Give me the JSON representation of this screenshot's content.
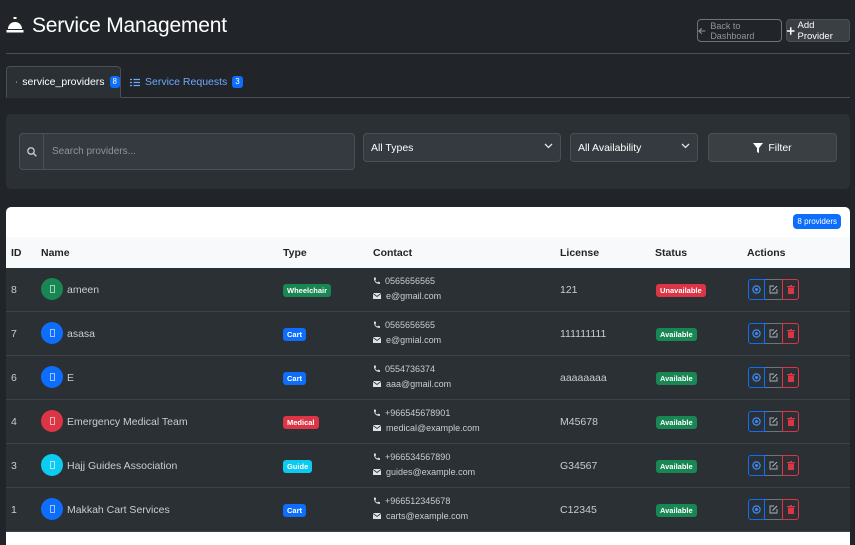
{
  "header": {
    "title": "Service Management",
    "back_label": "Back to Dashboard",
    "add_label": "Add Provider"
  },
  "tabs": [
    {
      "label": "service_providers",
      "count": "8",
      "active": true
    },
    {
      "label": "Service Requests",
      "count": "3",
      "active": false
    }
  ],
  "filters": {
    "search_placeholder": "Search providers...",
    "type_select": "All Types",
    "availability_select": "All Availability",
    "filter_label": "Filter"
  },
  "table": {
    "count_badge": "8 providers",
    "columns": [
      "ID",
      "Name",
      "Type",
      "Contact",
      "License",
      "Status",
      "Actions"
    ],
    "rows": [
      {
        "id": "8",
        "name": "ameen",
        "avatar_color": "#198754",
        "type": "Wheelchair",
        "type_color": "#198754",
        "phone": "0565656565",
        "email": "e@gmail.com",
        "license": "121",
        "status": "Unavailable",
        "status_color": "#dc3545"
      },
      {
        "id": "7",
        "name": "asasa",
        "avatar_color": "#0d6efd",
        "type": "Cart",
        "type_color": "#0d6efd",
        "phone": "0565656565",
        "email": "e@gmial.com",
        "license": "111111111",
        "status": "Available",
        "status_color": "#198754"
      },
      {
        "id": "6",
        "name": "E",
        "avatar_color": "#0d6efd",
        "type": "Cart",
        "type_color": "#0d6efd",
        "phone": "0554736374",
        "email": "aaa@gmail.com",
        "license": "aaaaaaaa",
        "status": "Available",
        "status_color": "#198754"
      },
      {
        "id": "4",
        "name": "Emergency Medical Team",
        "avatar_color": "#dc3545",
        "type": "Medical",
        "type_color": "#dc3545",
        "phone": "+966545678901",
        "email": "medical@example.com",
        "license": "M45678",
        "status": "Available",
        "status_color": "#198754"
      },
      {
        "id": "3",
        "name": "Hajj Guides Association",
        "avatar_color": "#0dcaf0",
        "type": "Guide",
        "type_color": "#0dcaf0",
        "phone": "+966534567890",
        "email": "guides@example.com",
        "license": "G34567",
        "status": "Available",
        "status_color": "#198754"
      },
      {
        "id": "1",
        "name": "Makkah Cart Services",
        "avatar_color": "#0d6efd",
        "type": "Cart",
        "type_color": "#0d6efd",
        "phone": "+966512345678",
        "email": "carts@example.com",
        "license": "C12345",
        "status": "Available",
        "status_color": "#198754"
      }
    ]
  }
}
